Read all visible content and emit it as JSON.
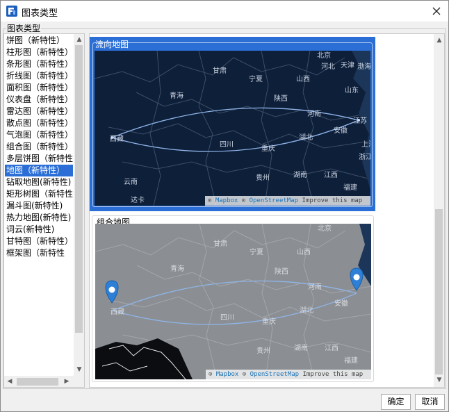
{
  "window": {
    "title": "图表类型"
  },
  "group_label": "图表类型",
  "chart_types": [
    {
      "label": "饼图（新特性）"
    },
    {
      "label": "柱形图（新特性）"
    },
    {
      "label": "条形图（新特性）"
    },
    {
      "label": "折线图（新特性）"
    },
    {
      "label": "面积图（新特性）"
    },
    {
      "label": "仪表盘（新特性）"
    },
    {
      "label": "雷达图（新特性）"
    },
    {
      "label": "散点图（新特性）"
    },
    {
      "label": "气泡图（新特性）"
    },
    {
      "label": "组合图（新特性）"
    },
    {
      "label": "多层饼图（新特性"
    },
    {
      "label": "地图（新特性）"
    },
    {
      "label": "钻取地图(新特性)"
    },
    {
      "label": "矩形树图（新特性"
    },
    {
      "label": "漏斗图(新特性)"
    },
    {
      "label": "热力地图(新特性)"
    },
    {
      "label": "词云(新特性)"
    },
    {
      "label": "甘特图（新特性）"
    },
    {
      "label": "框架图（新特性"
    }
  ],
  "selected_index": 11,
  "previews": [
    {
      "label": "流向地图",
      "selected": true
    },
    {
      "label": "组合地图",
      "selected": false
    }
  ],
  "map_places": [
    "北京",
    "天津",
    "河北",
    "渤海",
    "甘肃",
    "宁夏",
    "山西",
    "山东",
    "青海",
    "陕西",
    "河南",
    "江苏",
    "安徽",
    "西藏",
    "四川",
    "重庆",
    "湖北",
    "浙江",
    "上海",
    "贵州",
    "湖南",
    "江西",
    "福建",
    "云南",
    "达卡"
  ],
  "attribution": {
    "mapbox": "Mapbox",
    "osm": "OpenStreetMap",
    "improve": "Improve this map"
  },
  "buttons": {
    "ok": "确定",
    "cancel": "取消"
  },
  "colors": {
    "selection": "#2b6fd6",
    "map_dark": "#0e1f3a",
    "map_gray": "#8b8f94",
    "marker": "#2e7fd6"
  }
}
